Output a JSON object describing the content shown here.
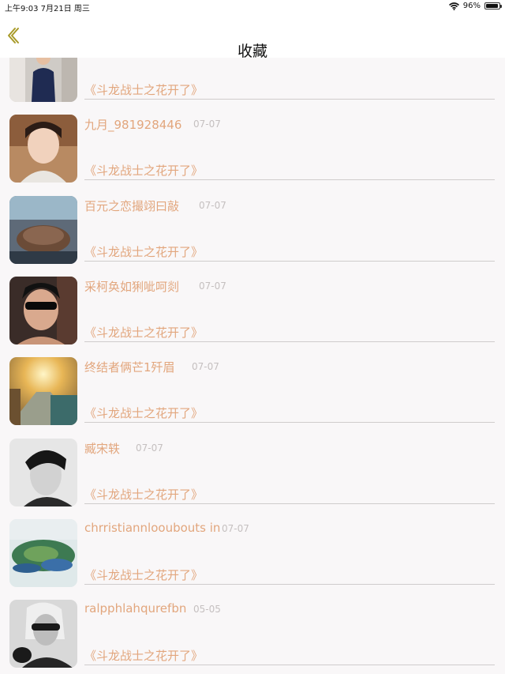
{
  "status_bar": {
    "time_date": "上午9:03   7月21日 周三",
    "wifi_icon": "wifi-icon",
    "battery_text": "96%",
    "battery_level": 0.96
  },
  "nav": {
    "back_icon": "chevron-left-icon",
    "title": "收藏"
  },
  "favorites": [
    {
      "name": "",
      "date": "",
      "work_title": "《斗龙战士之花开了》"
    },
    {
      "name": "九月_981928446",
      "date": "07-07",
      "work_title": "《斗龙战士之花开了》"
    },
    {
      "name": "百元之恋撮翊曰敲",
      "date": "07-07",
      "work_title": "《斗龙战士之花开了》"
    },
    {
      "name": "采柯奂如猁呲呵剡",
      "date": "07-07",
      "work_title": "《斗龙战士之花开了》"
    },
    {
      "name": "终结者俩芒1歼眉",
      "date": "07-07",
      "work_title": "《斗龙战士之花开了》"
    },
    {
      "name": "臧宋轶",
      "date": "07-07",
      "work_title": "《斗龙战士之花开了》"
    },
    {
      "name": "chrristiannlooubouts in",
      "date": "07-07",
      "work_title": "《斗龙战士之花开了》"
    },
    {
      "name": "ralpphlahqurefbn",
      "date": "05-05",
      "work_title": "《斗龙战士之花开了》"
    }
  ]
}
